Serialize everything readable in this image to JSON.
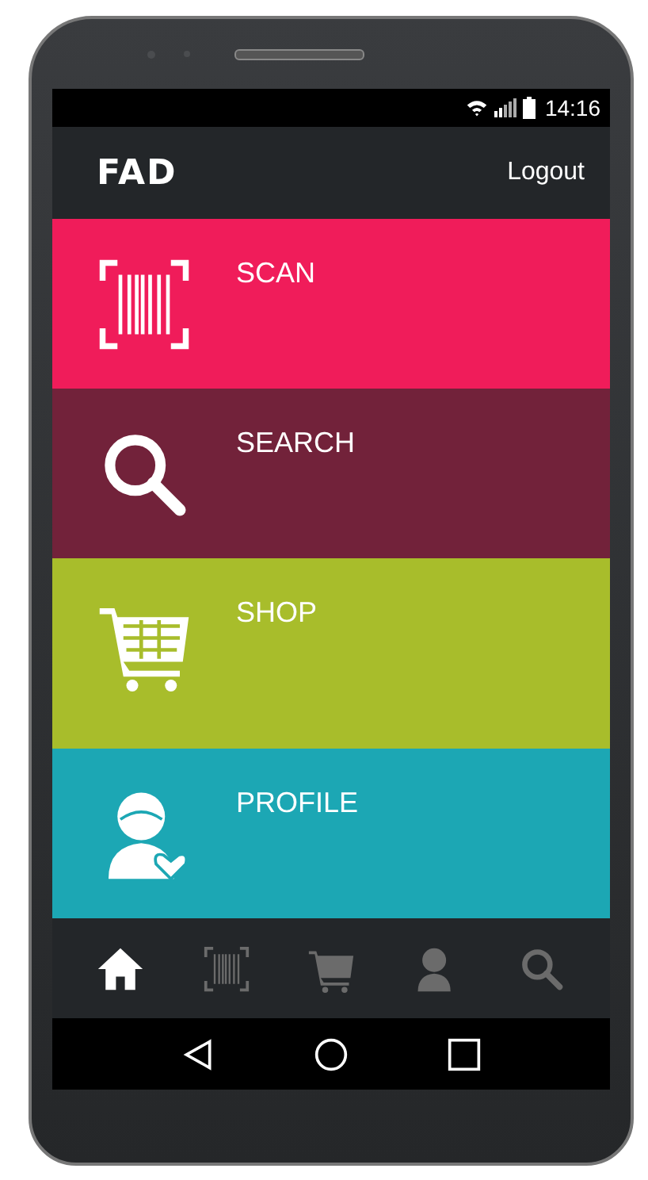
{
  "status_bar": {
    "time": "14:16"
  },
  "app_bar": {
    "logo": "FAD",
    "action": "Logout"
  },
  "tiles": [
    {
      "label": "SCAN",
      "kind": "scan",
      "color": "#f01c5a"
    },
    {
      "label": "SEARCH",
      "kind": "search",
      "color": "#72223a"
    },
    {
      "label": "SHOP",
      "kind": "shop",
      "color": "#a8bd2b"
    },
    {
      "label": "PROFILE",
      "kind": "profile",
      "color": "#1ca7b4"
    }
  ],
  "bottom_nav": [
    {
      "kind": "home",
      "selected": true
    },
    {
      "kind": "scan",
      "selected": false
    },
    {
      "kind": "shop",
      "selected": false
    },
    {
      "kind": "profile",
      "selected": false
    },
    {
      "kind": "search",
      "selected": false
    }
  ]
}
